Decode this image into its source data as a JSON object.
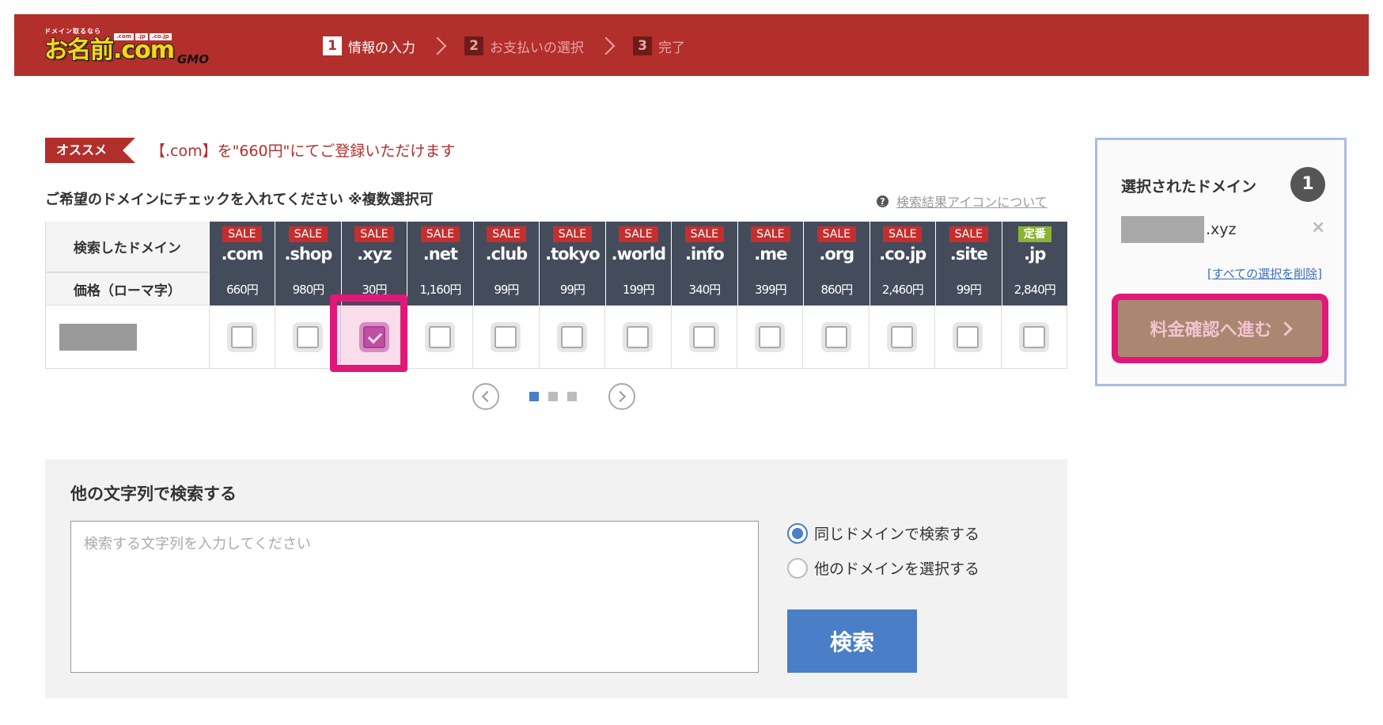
{
  "header": {
    "logo": {
      "tagline": "ドメイン取るなら",
      "tlds": [
        ".com",
        ".jp",
        ".co.jp"
      ],
      "main": "お名前.com",
      "by": "GMO"
    },
    "steps": [
      {
        "num": "1",
        "label": "情報の入力",
        "active": true
      },
      {
        "num": "2",
        "label": "お支払いの選択",
        "active": false
      },
      {
        "num": "3",
        "label": "完了",
        "active": false
      }
    ]
  },
  "recommend": {
    "badge": "オススメ",
    "text": "【.com】を\"660円\"にてご登録いただけます"
  },
  "instruction": "ご希望のドメインにチェックを入れてください ※複数選択可",
  "help_link": "検索結果アイコンについて",
  "table": {
    "header_label": "検索したドメイン",
    "price_label": "価格（ローマ字）",
    "tlds": [
      {
        "badge": "SALE",
        "name": ".com",
        "price": "660円",
        "checked": false
      },
      {
        "badge": "SALE",
        "name": ".shop",
        "price": "980円",
        "checked": false
      },
      {
        "badge": "SALE",
        "name": ".xyz",
        "price": "30円",
        "checked": true
      },
      {
        "badge": "SALE",
        "name": ".net",
        "price": "1,160円",
        "checked": false
      },
      {
        "badge": "SALE",
        "name": ".club",
        "price": "99円",
        "checked": false
      },
      {
        "badge": "SALE",
        "name": ".tokyo",
        "price": "99円",
        "checked": false
      },
      {
        "badge": "SALE",
        "name": ".world",
        "price": "199円",
        "checked": false
      },
      {
        "badge": "SALE",
        "name": ".info",
        "price": "340円",
        "checked": false
      },
      {
        "badge": "SALE",
        "name": ".me",
        "price": "399円",
        "checked": false
      },
      {
        "badge": "SALE",
        "name": ".org",
        "price": "860円",
        "checked": false
      },
      {
        "badge": "SALE",
        "name": ".co.jp",
        "price": "2,460円",
        "checked": false
      },
      {
        "badge": "SALE",
        "name": ".site",
        "price": "99円",
        "checked": false
      },
      {
        "badge": "定番",
        "name": ".jp",
        "price": "2,840円",
        "checked": false
      }
    ]
  },
  "pager": {
    "pages": 3,
    "current": 1
  },
  "selected_panel": {
    "title": "選択されたドメイン",
    "count": "1",
    "item_tld": ".xyz",
    "remove_icon": "×",
    "clear_all": "[すべての選択を削除]",
    "proceed_label": "料金確認へ進む"
  },
  "search_other": {
    "title": "他の文字列で検索する",
    "placeholder": "検索する文字列を入力してください",
    "value": "",
    "options": [
      {
        "label": "同じドメインで検索する",
        "checked": true
      },
      {
        "label": "他のドメインを選択する",
        "checked": false
      }
    ],
    "button": "検索"
  },
  "colors": {
    "header_bg": "#b22f2c",
    "table_head_bg": "#444c5b",
    "sale_badge": "#c62e2e",
    "regular_badge": "#8cb334",
    "accent_blue": "#4a7ec6",
    "highlight": "#e0187a"
  }
}
